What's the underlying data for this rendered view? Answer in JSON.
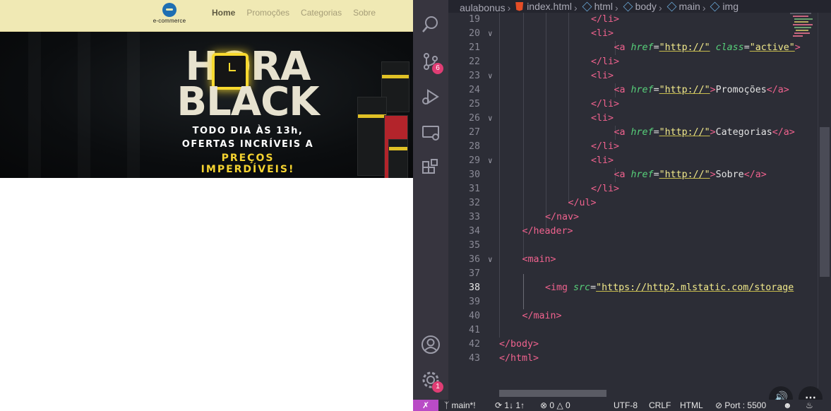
{
  "preview": {
    "logo_text": "e-commerce",
    "nav": [
      {
        "label": "Home",
        "active": true
      },
      {
        "label": "Promoções",
        "active": false
      },
      {
        "label": "Categorias",
        "active": false
      },
      {
        "label": "Sobre",
        "active": false
      }
    ],
    "banner": {
      "title_line1": "HORA",
      "title_line2": "BLACK",
      "sub1": "TODO DIA ÀS 13h,",
      "sub2": "OFERTAS INCRÍVEIS A",
      "sub3": "PREÇOS IMPERDÍVEIS!"
    }
  },
  "editor": {
    "breadcrumb": [
      "aulabonus",
      "index.html",
      "html",
      "body",
      "main",
      "img"
    ],
    "current_line": 38,
    "lines": [
      {
        "n": "19",
        "fold": false
      },
      {
        "n": "20",
        "fold": true
      },
      {
        "n": "21",
        "fold": false
      },
      {
        "n": "22",
        "fold": false
      },
      {
        "n": "23",
        "fold": true
      },
      {
        "n": "24",
        "fold": false
      },
      {
        "n": "25",
        "fold": false
      },
      {
        "n": "26",
        "fold": true
      },
      {
        "n": "27",
        "fold": false
      },
      {
        "n": "28",
        "fold": false
      },
      {
        "n": "29",
        "fold": true
      },
      {
        "n": "30",
        "fold": false
      },
      {
        "n": "31",
        "fold": false
      },
      {
        "n": "32",
        "fold": false
      },
      {
        "n": "33",
        "fold": false
      },
      {
        "n": "34",
        "fold": false
      },
      {
        "n": "35",
        "fold": false
      },
      {
        "n": "36",
        "fold": true
      },
      {
        "n": "37",
        "fold": false
      },
      {
        "n": "38",
        "fold": false
      },
      {
        "n": "39",
        "fold": false
      },
      {
        "n": "40",
        "fold": false
      },
      {
        "n": "41",
        "fold": false
      },
      {
        "n": "42",
        "fold": false
      },
      {
        "n": "43",
        "fold": false
      }
    ],
    "code": {
      "l19": "</li>",
      "l20": "<li>",
      "l21_tag": "<a ",
      "l21_attr1": "href",
      "l21_eq1": "=",
      "l21_val1": "\"http://\"",
      "l21_attr2": "class",
      "l21_eq2": "=",
      "l21_val2": "\"active\"",
      "l21_rest": ">",
      "l22": "</li>",
      "l23": "<li>",
      "l24_tag": "<a ",
      "l24_attr": "href",
      "l24_eq": "=",
      "l24_val": "\"http://\"",
      "l24_close": ">",
      "l24_text": "Promoções",
      "l24_end": "</a>",
      "l25": "</li>",
      "l26": "<li>",
      "l27_tag": "<a ",
      "l27_attr": "href",
      "l27_eq": "=",
      "l27_val": "\"http://\"",
      "l27_close": ">",
      "l27_text": "Categorias",
      "l27_end": "</a>",
      "l28": "</li>",
      "l29": "<li>",
      "l30_tag": "<a ",
      "l30_attr": "href",
      "l30_eq": "=",
      "l30_val": "\"http://\"",
      "l30_close": ">",
      "l30_text": "Sobre",
      "l30_end": "</a>",
      "l31": "</li>",
      "l32": "</ul>",
      "l33": "</nav>",
      "l34": "</header>",
      "l36": "<main>",
      "l38_tag": "<img ",
      "l38_attr": "src",
      "l38_eq": "=",
      "l38_val": "\"https://http2.mlstatic.com/storage",
      "l40": "</main>",
      "l42": "</body>",
      "l43": "</html>"
    }
  },
  "activity": {
    "scm_badge": "6",
    "settings_badge": "1"
  },
  "status": {
    "branch": "main*!",
    "sync": "1↓ 1↑",
    "errors": "0",
    "warnings": "0",
    "encoding": "UTF-8",
    "eol": "CRLF",
    "language": "HTML",
    "port": "Port : 5500"
  },
  "colors": {
    "tag": "#f0628e",
    "attribute": "#57d07a",
    "string": "#f1e98b",
    "remote_indicator": "#b94bc6",
    "badge": "#e03d74"
  }
}
